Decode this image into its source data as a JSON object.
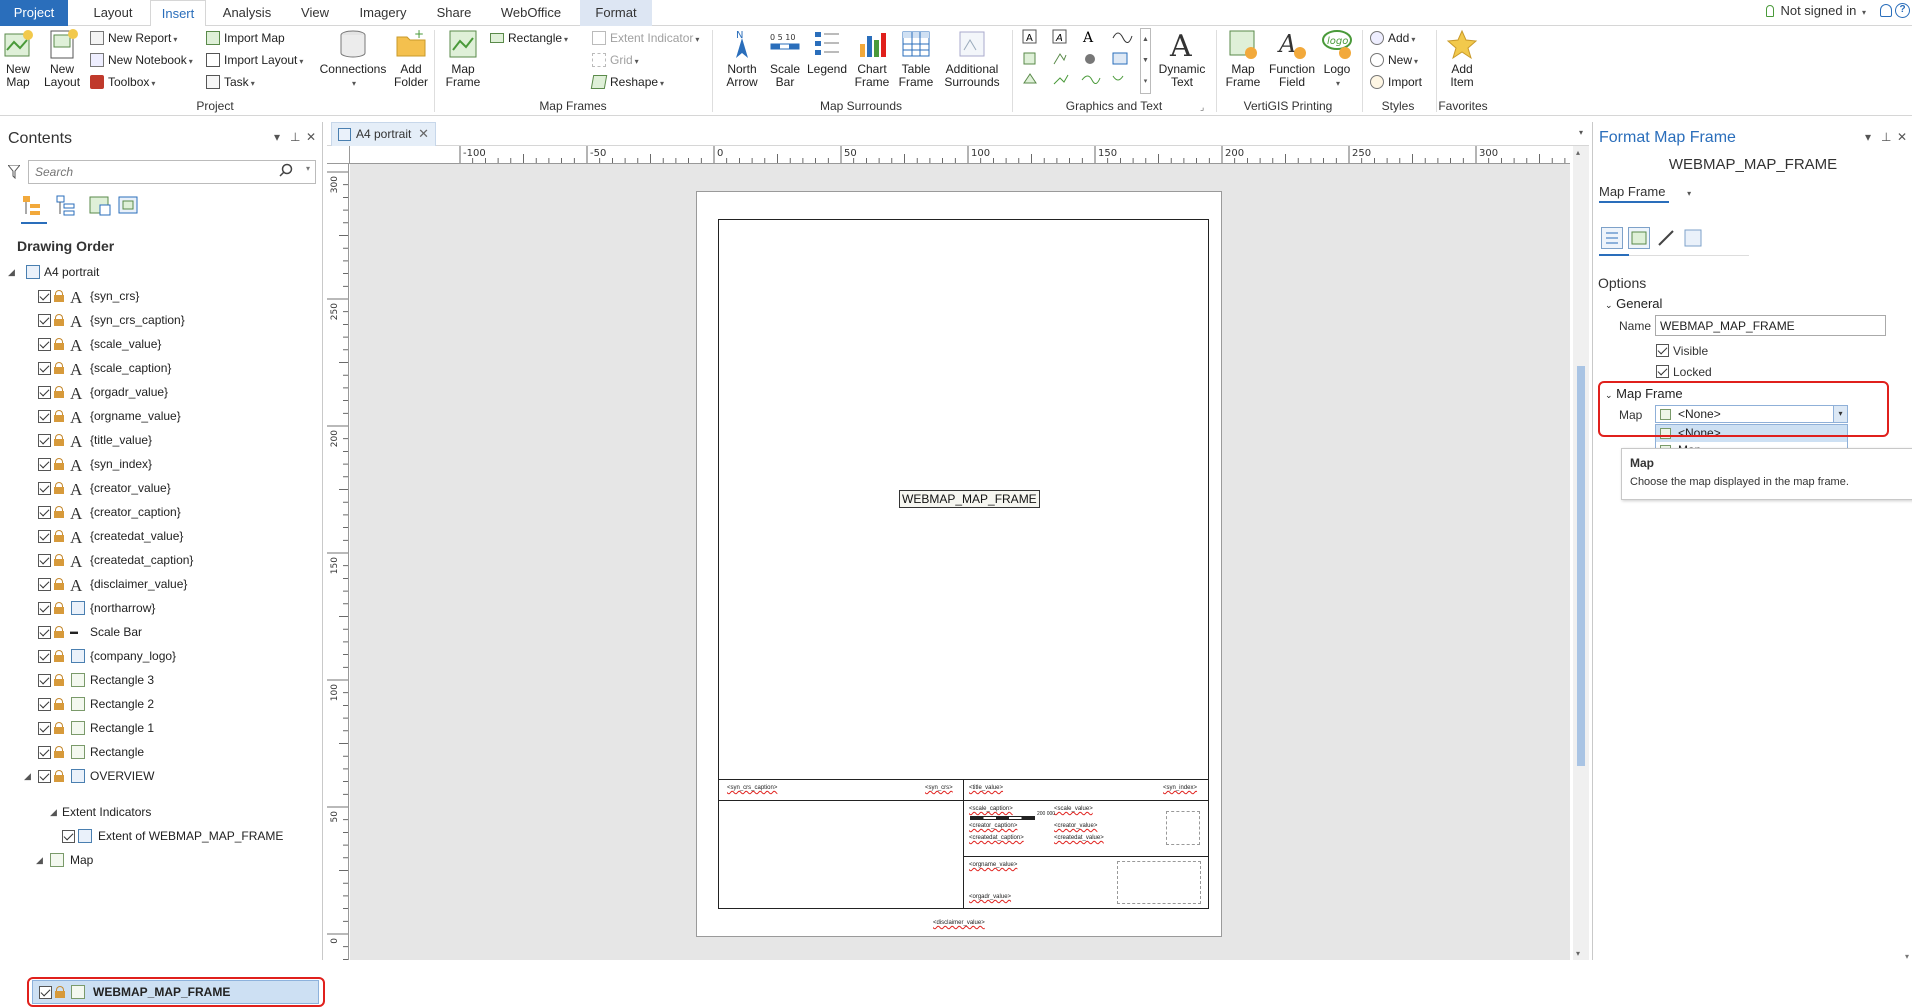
{
  "tabs": [
    "Project",
    "Layout",
    "Insert",
    "Analysis",
    "View",
    "Imagery",
    "Share",
    "WebOffice",
    "Format"
  ],
  "active_tab": "Insert",
  "signin": "Not signed in",
  "ribbon": {
    "project": {
      "new_map": "New Map",
      "new_layout": "New Layout",
      "new_report": "New Report",
      "new_notebook": "New Notebook",
      "toolbox": "Toolbox",
      "import_map": "Import Map",
      "import_layout": "Import Layout",
      "task": "Task",
      "connections": "Connections",
      "add_folder": "Add Folder",
      "label": "Project"
    },
    "map_frames": {
      "map_frame": "Map Frame",
      "rectangle": "Rectangle",
      "extent_indicator": "Extent Indicator",
      "grid": "Grid",
      "reshape": "Reshape",
      "label": "Map Frames"
    },
    "map_surrounds": {
      "north_arrow": "North Arrow",
      "scale_bar": "Scale Bar",
      "legend": "Legend",
      "chart_frame": "Chart Frame",
      "table_frame": "Table Frame",
      "additional_surrounds": "Additional Surrounds",
      "label": "Map Surrounds"
    },
    "graphics": {
      "dynamic_text": "Dynamic Text",
      "label": "Graphics and Text"
    },
    "vertigis": {
      "map_frame": "Map Frame",
      "function_field": "Function Field",
      "logo": "Logo",
      "label": "VertiGIS Printing"
    },
    "styles": {
      "add": "Add",
      "new": "New",
      "import": "Import",
      "label": "Styles"
    },
    "favorites": {
      "add_item": "Add Item",
      "label": "Favorites"
    }
  },
  "contents": {
    "title": "Contents",
    "search_placeholder": "Search",
    "drawing_order": "Drawing Order",
    "root": "A4 portrait",
    "items": [
      "{syn_crs}",
      "{syn_crs_caption}",
      "{scale_value}",
      "{scale_caption}",
      "{orgadr_value}",
      "{orgname_value}",
      "{title_value}",
      "{syn_index}",
      "{creator_value}",
      "{creator_caption}",
      "{createdat_value}",
      "{createdat_caption}",
      "{disclaimer_value}",
      "{northarrow}",
      "Scale Bar",
      "{company_logo}",
      "Rectangle 3",
      "Rectangle 2",
      "Rectangle 1",
      "Rectangle",
      "OVERVIEW"
    ],
    "extent_indicators": "Extent Indicators",
    "extent_item": "Extent of WEBMAP_MAP_FRAME",
    "map": "Map",
    "selected": "WEBMAP_MAP_FRAME"
  },
  "doc_tab": "A4 portrait",
  "hruler": [
    "-100",
    "-50",
    "0",
    "50",
    "100",
    "150",
    "200",
    "250",
    "300"
  ],
  "vruler": [
    "300",
    "250",
    "200",
    "150",
    "100",
    "50",
    "0"
  ],
  "page": {
    "map_frame_label": "WEBMAP_MAP_FRAME",
    "fields": {
      "syn_crs_caption": "<syn_crs_caption>",
      "syn_crs": "<syn_crs>",
      "title_value": "<title_value>",
      "syn_index": "<syn_index>",
      "scale_caption": "<scale_caption>",
      "scale_value": "<scale_value>",
      "creator_caption": "<creator_caption>",
      "creator_value": "<creator_value>",
      "createdat_caption": "<createdat_caption>",
      "createdat_value": "<createdat_value>",
      "orgname_value": "<orgname_value>",
      "orgadr_value": "<orgadr_value>",
      "disclaimer_value": "<disclaimer_value>",
      "scalebar_num": "200 000"
    }
  },
  "format_pane": {
    "title": "Format Map Frame",
    "element": "WEBMAP_MAP_FRAME",
    "dropdown": "Map Frame",
    "options": "Options",
    "general": "General",
    "name_label": "Name",
    "name_value": "WEBMAP_MAP_FRAME",
    "visible": "Visible",
    "locked": "Locked",
    "map_frame_section": "Map Frame",
    "map_label": "Map",
    "map_value": "<None>",
    "map_options": [
      "<None>",
      "Map"
    ],
    "tooltip_title": "Map",
    "tooltip_body": "Choose the map displayed in the map frame."
  }
}
